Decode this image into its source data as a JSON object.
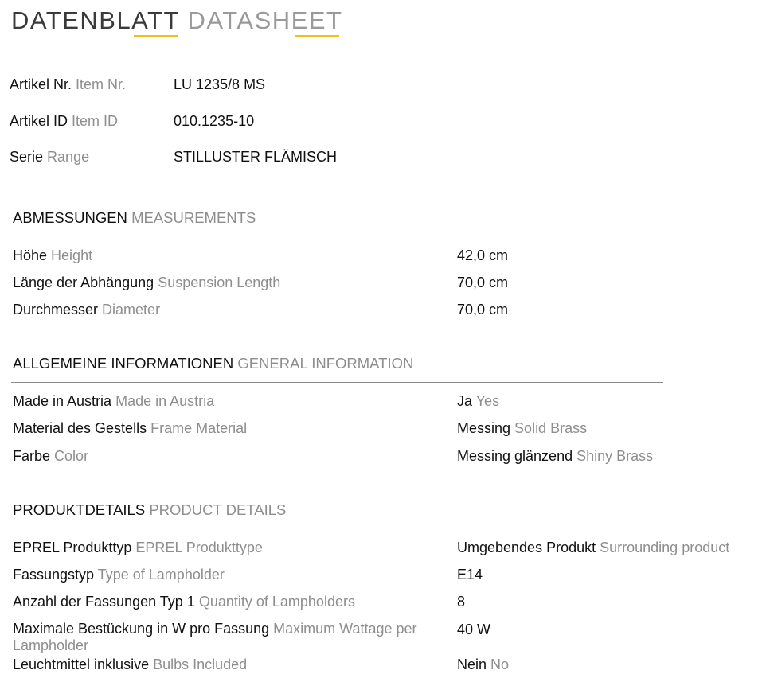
{
  "title": {
    "de": "DATENBLATT",
    "en": "DATASHEET"
  },
  "accent_color": "#f1c21b",
  "item": [
    {
      "de": "Artikel Nr.",
      "en": "Item Nr.",
      "value": "LU 1235/8 MS"
    },
    {
      "de": "Artikel ID",
      "en": "Item ID",
      "value": "010.1235-10"
    },
    {
      "de": "Serie",
      "en": "Range",
      "value": "STILLUSTER FLÄMISCH"
    }
  ],
  "sections": [
    {
      "de": "ABMESSUNGEN",
      "en": "MEASUREMENTS",
      "rows": [
        {
          "de": "Höhe",
          "en": "Height",
          "value_de": "42,0 cm",
          "value_en": ""
        },
        {
          "de": "Länge der Abhängung",
          "en": "Suspension Length",
          "value_de": "70,0 cm",
          "value_en": ""
        },
        {
          "de": "Durchmesser",
          "en": "Diameter",
          "value_de": "70,0 cm",
          "value_en": ""
        }
      ]
    },
    {
      "de": "ALLGEMEINE INFORMATIONEN",
      "en": "GENERAL INFORMATION",
      "rows": [
        {
          "de": "Made in Austria",
          "en": "Made in Austria",
          "value_de": "Ja",
          "value_en": "Yes"
        },
        {
          "de": "Material des Gestells",
          "en": "Frame Material",
          "value_de": "Messing",
          "value_en": "Solid Brass"
        },
        {
          "de": "Farbe",
          "en": "Color",
          "value_de": "Messing glänzend",
          "value_en": "Shiny Brass"
        }
      ]
    },
    {
      "de": "PRODUKTDETAILS",
      "en": "PRODUCT DETAILS",
      "rows": [
        {
          "de": "EPREL Produkttyp",
          "en": "EPREL Produkttype",
          "value_de": "Umgebendes Produkt",
          "value_en": "Surrounding product"
        },
        {
          "de": "Fassungstyp",
          "en": "Type of Lampholder",
          "value_de": "E14",
          "value_en": ""
        },
        {
          "de": "Anzahl der Fassungen Typ 1",
          "en": "Quantity of Lampholders",
          "value_de": "8",
          "value_en": ""
        },
        {
          "de": "Maximale Bestückung in W pro Fassung",
          "en": "Maximum Wattage per Lampholder",
          "value_de": "40 W",
          "value_en": ""
        },
        {
          "de": "Leuchtmittel inklusive",
          "en": "Bulbs Included",
          "value_de": "Nein",
          "value_en": "No"
        }
      ]
    }
  ]
}
